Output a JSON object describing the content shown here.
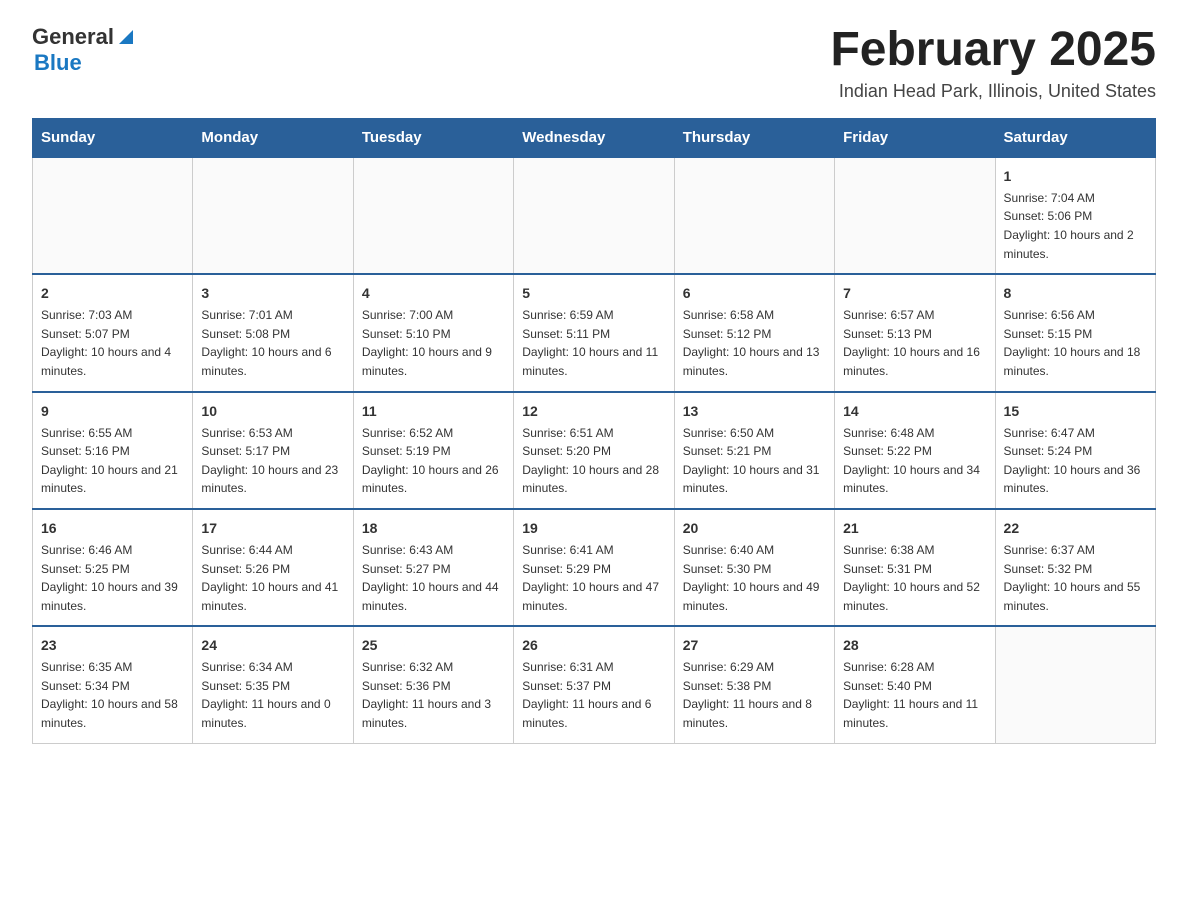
{
  "header": {
    "logo": {
      "general": "General",
      "blue": "Blue"
    },
    "title": "February 2025",
    "subtitle": "Indian Head Park, Illinois, United States"
  },
  "days_of_week": [
    "Sunday",
    "Monday",
    "Tuesday",
    "Wednesday",
    "Thursday",
    "Friday",
    "Saturday"
  ],
  "weeks": [
    [
      {
        "day": "",
        "info": ""
      },
      {
        "day": "",
        "info": ""
      },
      {
        "day": "",
        "info": ""
      },
      {
        "day": "",
        "info": ""
      },
      {
        "day": "",
        "info": ""
      },
      {
        "day": "",
        "info": ""
      },
      {
        "day": "1",
        "info": "Sunrise: 7:04 AM\nSunset: 5:06 PM\nDaylight: 10 hours and 2 minutes."
      }
    ],
    [
      {
        "day": "2",
        "info": "Sunrise: 7:03 AM\nSunset: 5:07 PM\nDaylight: 10 hours and 4 minutes."
      },
      {
        "day": "3",
        "info": "Sunrise: 7:01 AM\nSunset: 5:08 PM\nDaylight: 10 hours and 6 minutes."
      },
      {
        "day": "4",
        "info": "Sunrise: 7:00 AM\nSunset: 5:10 PM\nDaylight: 10 hours and 9 minutes."
      },
      {
        "day": "5",
        "info": "Sunrise: 6:59 AM\nSunset: 5:11 PM\nDaylight: 10 hours and 11 minutes."
      },
      {
        "day": "6",
        "info": "Sunrise: 6:58 AM\nSunset: 5:12 PM\nDaylight: 10 hours and 13 minutes."
      },
      {
        "day": "7",
        "info": "Sunrise: 6:57 AM\nSunset: 5:13 PM\nDaylight: 10 hours and 16 minutes."
      },
      {
        "day": "8",
        "info": "Sunrise: 6:56 AM\nSunset: 5:15 PM\nDaylight: 10 hours and 18 minutes."
      }
    ],
    [
      {
        "day": "9",
        "info": "Sunrise: 6:55 AM\nSunset: 5:16 PM\nDaylight: 10 hours and 21 minutes."
      },
      {
        "day": "10",
        "info": "Sunrise: 6:53 AM\nSunset: 5:17 PM\nDaylight: 10 hours and 23 minutes."
      },
      {
        "day": "11",
        "info": "Sunrise: 6:52 AM\nSunset: 5:19 PM\nDaylight: 10 hours and 26 minutes."
      },
      {
        "day": "12",
        "info": "Sunrise: 6:51 AM\nSunset: 5:20 PM\nDaylight: 10 hours and 28 minutes."
      },
      {
        "day": "13",
        "info": "Sunrise: 6:50 AM\nSunset: 5:21 PM\nDaylight: 10 hours and 31 minutes."
      },
      {
        "day": "14",
        "info": "Sunrise: 6:48 AM\nSunset: 5:22 PM\nDaylight: 10 hours and 34 minutes."
      },
      {
        "day": "15",
        "info": "Sunrise: 6:47 AM\nSunset: 5:24 PM\nDaylight: 10 hours and 36 minutes."
      }
    ],
    [
      {
        "day": "16",
        "info": "Sunrise: 6:46 AM\nSunset: 5:25 PM\nDaylight: 10 hours and 39 minutes."
      },
      {
        "day": "17",
        "info": "Sunrise: 6:44 AM\nSunset: 5:26 PM\nDaylight: 10 hours and 41 minutes."
      },
      {
        "day": "18",
        "info": "Sunrise: 6:43 AM\nSunset: 5:27 PM\nDaylight: 10 hours and 44 minutes."
      },
      {
        "day": "19",
        "info": "Sunrise: 6:41 AM\nSunset: 5:29 PM\nDaylight: 10 hours and 47 minutes."
      },
      {
        "day": "20",
        "info": "Sunrise: 6:40 AM\nSunset: 5:30 PM\nDaylight: 10 hours and 49 minutes."
      },
      {
        "day": "21",
        "info": "Sunrise: 6:38 AM\nSunset: 5:31 PM\nDaylight: 10 hours and 52 minutes."
      },
      {
        "day": "22",
        "info": "Sunrise: 6:37 AM\nSunset: 5:32 PM\nDaylight: 10 hours and 55 minutes."
      }
    ],
    [
      {
        "day": "23",
        "info": "Sunrise: 6:35 AM\nSunset: 5:34 PM\nDaylight: 10 hours and 58 minutes."
      },
      {
        "day": "24",
        "info": "Sunrise: 6:34 AM\nSunset: 5:35 PM\nDaylight: 11 hours and 0 minutes."
      },
      {
        "day": "25",
        "info": "Sunrise: 6:32 AM\nSunset: 5:36 PM\nDaylight: 11 hours and 3 minutes."
      },
      {
        "day": "26",
        "info": "Sunrise: 6:31 AM\nSunset: 5:37 PM\nDaylight: 11 hours and 6 minutes."
      },
      {
        "day": "27",
        "info": "Sunrise: 6:29 AM\nSunset: 5:38 PM\nDaylight: 11 hours and 8 minutes."
      },
      {
        "day": "28",
        "info": "Sunrise: 6:28 AM\nSunset: 5:40 PM\nDaylight: 11 hours and 11 minutes."
      },
      {
        "day": "",
        "info": ""
      }
    ]
  ]
}
